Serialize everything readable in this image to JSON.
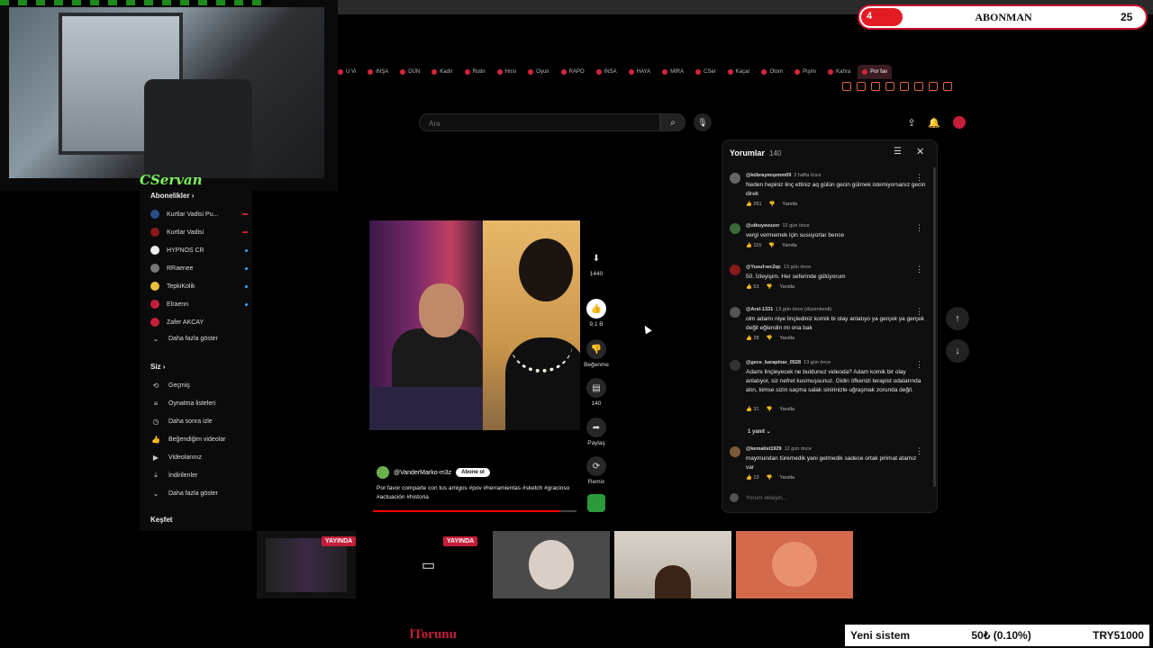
{
  "stream": {
    "streamer_name": "CServan",
    "sub_widget": {
      "count": "4",
      "label": "ABONMAN",
      "goal": "25"
    },
    "bottom_name": "lTorunu",
    "ticker": {
      "title": "Yeni sistem",
      "amount": "50₺ (0.10%)",
      "total": "TRY51000"
    },
    "live_badges": [
      "YAYINDA",
      "YAYINDA"
    ]
  },
  "browser": {
    "tabs": [
      "U Vi",
      "INŞA",
      "DÜN",
      "Kadır",
      "Rutin",
      "Hırsı",
      "Oyun",
      "RAPO",
      "INSA",
      "HAYA",
      "MİRA",
      "CSer",
      "Kaçar",
      "Otom",
      "Pişmı",
      "Kahra",
      "Por fav"
    ],
    "active_tab": "Por fav"
  },
  "youtube": {
    "search": {
      "placeholder": "Ara"
    },
    "icons": {
      "search": "search-icon",
      "mic": "mic-icon",
      "upload": "upload-icon",
      "bell": "bell-icon"
    },
    "sidebar": {
      "subscriptions_title": "Abonelikler",
      "subscriptions": [
        {
          "label": "Kurtlar Vadisi Pu..."
        },
        {
          "label": "Kurtlar Vadisi"
        },
        {
          "label": "HYPNOS CR"
        },
        {
          "label": "RRaenee"
        },
        {
          "label": "TepkiKolik"
        },
        {
          "label": "Elraenn"
        },
        {
          "label": "Zafer AKCAY"
        }
      ],
      "show_more_subs": "Daha fazla göster",
      "you_title": "Siz",
      "you_items": [
        {
          "label": "Geçmiş",
          "icon": "⟲"
        },
        {
          "label": "Oynatma listeleri",
          "icon": "≡"
        },
        {
          "label": "Daha sonra izle",
          "icon": "◷"
        },
        {
          "label": "Beğendiğim videolar",
          "icon": "👍"
        },
        {
          "label": "Videolarınız",
          "icon": "▶"
        },
        {
          "label": "İndirilenler",
          "icon": "⤓"
        }
      ],
      "show_more_you": "Daha fazla göster",
      "explore_title": "Keşfet"
    },
    "short": {
      "channel": "@VanderMarko-m3z",
      "subscribe_label": "Abone ol",
      "description": "Por favor comparte con tus amigos #pov #herramientas #sketch #gracioso #actuación #historia",
      "progress": 0.92,
      "actions": {
        "download_count": "1440",
        "like_count": "9,1 B",
        "dislike_label": "Beğenme",
        "comment_count": "140",
        "share_label": "Paylaş",
        "remix_label": "Remix"
      }
    },
    "comments": {
      "title": "Yorumlar",
      "count": "140",
      "reply_label": "Yanıtla",
      "input_placeholder": "Yorum ekleyin...",
      "replies_toggle": "1 yanıt",
      "items": [
        {
          "author": "@kübraymışımm09",
          "time": "2 hafta önce",
          "text": "Neden hepiniz linç ettiniz aq gülün gecin gülmek istemiyorsanız gecin direk",
          "likes": "261"
        },
        {
          "author": "@utkuyavuzer",
          "time": "12 gün önce",
          "text": "vergi vermemek için susuyorlar bence",
          "likes": "115"
        },
        {
          "author": "@Yusuf-wc2qc",
          "time": "13 gün önce",
          "text": "50. İzleyişim. Her seferinde gülüyorum",
          "likes": "53"
        },
        {
          "author": "@Arel-1331",
          "time": "13 gün önce (düzenlendi)",
          "text": "olm adamı niye linçlediniz komik bi olay anlatıyo ya gerçek ya gerçek değil eğlendin mi ona bak",
          "likes": "28"
        },
        {
          "author": "@gece_karapinar_0528",
          "time": "13 gün önce",
          "text": "Adamı linçleyecek ne buldunuz videoda? Adam komik bir olay anlatıyor, siz nefret kusmuşsunuz. Gidin öfkenizi terapist odalarında atın, kimse sizin saçma salak sinirinizle uğraşmak zorunda değil.",
          "likes": "31"
        },
        {
          "author": "@kemalist1929",
          "time": "12 gün önce",
          "text": "maymundan türemedik  yani gelmedik sadece ortak pirimat atamız var",
          "likes": "13"
        }
      ]
    }
  }
}
